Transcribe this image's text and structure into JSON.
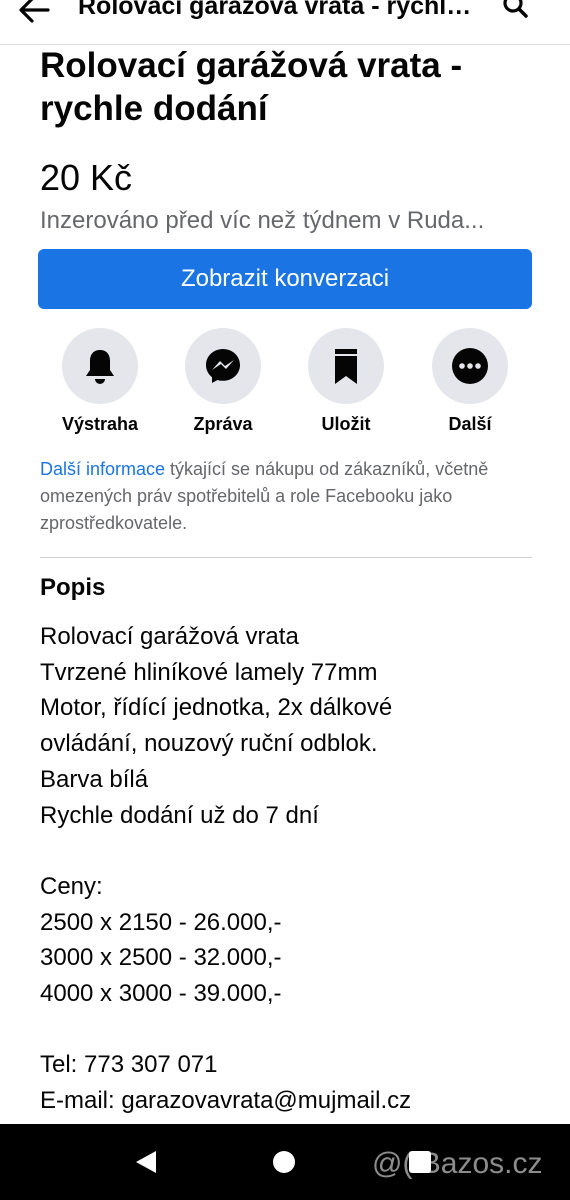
{
  "header": {
    "title": "Rolovací garážová vrata - rychle dodání",
    "back_icon": "back-arrow-icon",
    "search_icon": "search-icon"
  },
  "listing": {
    "title": "Rolovací garážová vrata - rychle dodání",
    "price": "20 Kč",
    "posted": "Inzerováno před víc než týdnem v Ruda..."
  },
  "primary_button": {
    "label": "Zobrazit konverzaci",
    "color": "#1b74e4"
  },
  "actions": [
    {
      "label": "Výstraha",
      "icon": "bell-icon"
    },
    {
      "label": "Zpráva",
      "icon": "messenger-icon"
    },
    {
      "label": "Uložit",
      "icon": "bookmark-icon"
    },
    {
      "label": "Další",
      "icon": "more-icon"
    }
  ],
  "info": {
    "link_text": "Další informace",
    "text": " týkající se nákupu od zákazníků, včetně omezených práv spotřebitelů a role Facebooku jako zprostředkovatele."
  },
  "description": {
    "heading": "Popis",
    "lines": [
      "Rolovací garážová vrata",
      "Tvrzené hliníkové lamely 77mm",
      "Motor, řídící jednotka, 2x dálkové",
      "ovládání, nouzový ruční odblok.",
      "Barva bílá",
      "Rychle dodání už do 7 dní",
      "",
      "Ceny:",
      "2500 x 2150 - 26.000,-",
      "3000 x 2500 - 32.000,-",
      "4000 x 3000 - 39.000,-",
      "",
      "Tel: 773 307 071",
      "E-mail: garazovavrata@mujmail.cz"
    ]
  },
  "system_nav": {
    "back_icon": "nav-back-icon",
    "home_icon": "nav-home-icon",
    "recents_icon": "nav-recents-icon"
  },
  "watermark": "@( Bazos.cz"
}
